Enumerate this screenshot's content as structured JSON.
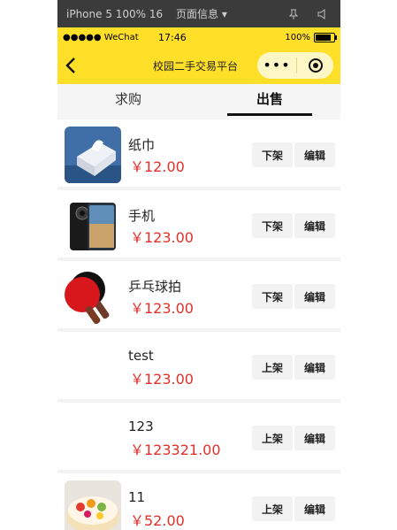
{
  "devtools": {
    "device": "iPhone 5 100% 16",
    "page_info": "页面信息 ▾"
  },
  "status_bar": {
    "signal": "●●●●● WeChat",
    "time": "17:46",
    "battery": "100%"
  },
  "navbar": {
    "title": "校园二手交易平台",
    "more": "•••"
  },
  "tabs": [
    {
      "label": "求购",
      "active": false
    },
    {
      "label": "出售",
      "active": true
    }
  ],
  "items": [
    {
      "name": "纸巾",
      "price": "￥12.00",
      "thumb": "tissue-image",
      "action_label": "下架",
      "edit_label": "编辑"
    },
    {
      "name": "手机",
      "price": "￥123.00",
      "thumb": "phone-image",
      "action_label": "下架",
      "edit_label": "编辑"
    },
    {
      "name": "乒乓球拍",
      "price": "￥123.00",
      "thumb": "paddle-image",
      "action_label": "下架",
      "edit_label": "编辑"
    },
    {
      "name": "test",
      "price": "￥123.00",
      "thumb": "",
      "action_label": "上架",
      "edit_label": "编辑"
    },
    {
      "name": "123",
      "price": "￥123321.00",
      "thumb": "",
      "action_label": "上架",
      "edit_label": "编辑"
    },
    {
      "name": "11",
      "price": "￥52.00",
      "thumb": "cake-image",
      "action_label": "上架",
      "edit_label": "编辑"
    }
  ],
  "colors": {
    "header": "#ffdf27",
    "price": "#e0302a"
  }
}
